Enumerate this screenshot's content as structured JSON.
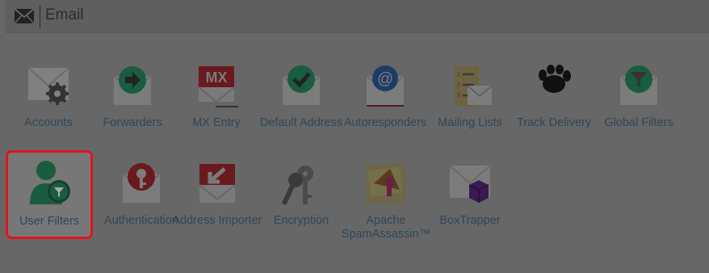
{
  "section": {
    "title": "Email",
    "icon": "envelope-icon"
  },
  "items": [
    {
      "label": "Accounts",
      "icon": "accounts-icon"
    },
    {
      "label": "Forwarders",
      "icon": "forwarders-icon"
    },
    {
      "label": "MX Entry",
      "icon": "mx-entry-icon",
      "badge": "MX"
    },
    {
      "label": "Default Address",
      "icon": "default-address-icon"
    },
    {
      "label": "Autoresponders",
      "icon": "autoresponders-icon",
      "badge": "@"
    },
    {
      "label": "Mailing Lists",
      "icon": "mailing-lists-icon",
      "badge_lines": [
        "1",
        "2",
        "3"
      ]
    },
    {
      "label": "Track Delivery",
      "icon": "track-delivery-icon"
    },
    {
      "label": "Global Filters",
      "icon": "global-filters-icon"
    },
    {
      "label": "User Filters",
      "icon": "user-filters-icon",
      "selected": true
    },
    {
      "label": "Authentication",
      "icon": "authentication-icon"
    },
    {
      "label": "Address Importer",
      "icon": "address-importer-icon"
    },
    {
      "label": "Encryption",
      "icon": "encryption-icon"
    },
    {
      "label": "Apache SpamAssassin™",
      "icon": "spamassassin-icon"
    },
    {
      "label": "BoxTrapper",
      "icon": "boxtrapper-icon"
    }
  ],
  "colors": {
    "overlay": "#676767",
    "label": "#2e4658",
    "highlight": "#e2141d",
    "green": "#1a5c40",
    "red": "#6a1a1e",
    "blue": "#1d3c66"
  }
}
